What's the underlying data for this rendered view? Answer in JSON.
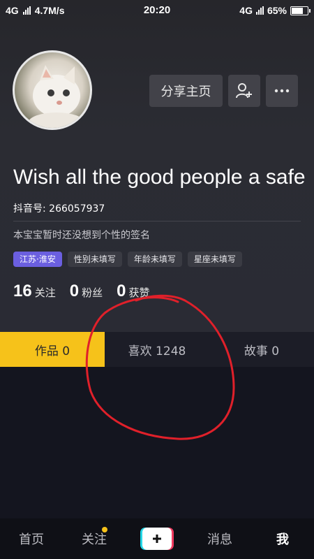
{
  "status": {
    "network_left": "4G",
    "speed": "4.7M/s",
    "time": "20:20",
    "network_right": "4G",
    "battery": "65%",
    "battery_level": 0.65
  },
  "profile": {
    "share_label": "分享主页",
    "nickname": "Wish all the good people a safe",
    "douyin_id": "抖音号: 266057937",
    "signature": "本宝宝暂时还没想到个性的签名",
    "tags": [
      "江苏·淮安",
      "性别未填写",
      "年龄未填写",
      "星座未填写"
    ],
    "stats": [
      {
        "num": "16",
        "label": "关注"
      },
      {
        "num": "0",
        "label": "粉丝"
      },
      {
        "num": "0",
        "label": "获赞"
      }
    ]
  },
  "tabs": [
    "作品 0",
    "喜欢 1248",
    "故事 0"
  ],
  "bottom_nav": [
    "首页",
    "关注",
    "消息",
    "我"
  ],
  "colors": {
    "accent": "#f6c21a",
    "location_tag": "#6b5fe0",
    "annotation": "#e0202a"
  }
}
